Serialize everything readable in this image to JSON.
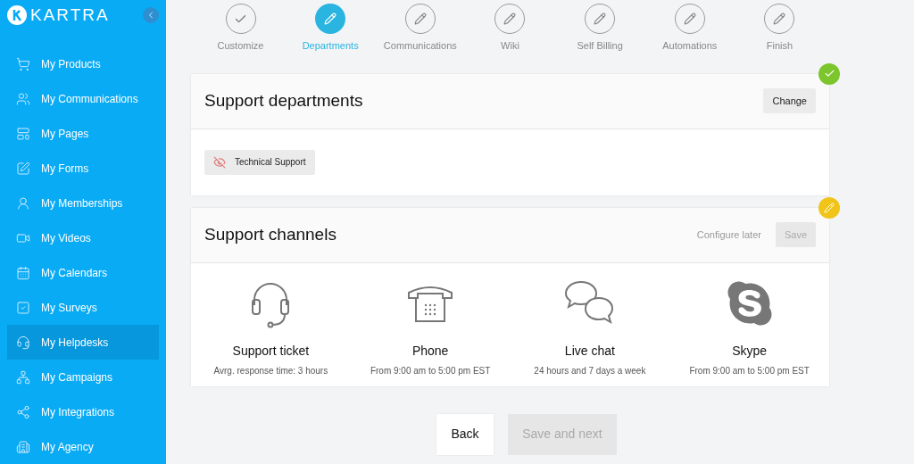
{
  "sidebar": {
    "brand": "KARTRA",
    "items": [
      {
        "label": "My Products",
        "selected": false
      },
      {
        "label": "My Communications",
        "selected": false
      },
      {
        "label": "My Pages",
        "selected": false
      },
      {
        "label": "My Forms",
        "selected": false
      },
      {
        "label": "My Memberships",
        "selected": false
      },
      {
        "label": "My Videos",
        "selected": false
      },
      {
        "label": "My Calendars",
        "selected": false
      },
      {
        "label": "My Surveys",
        "selected": false
      },
      {
        "label": "My Helpdesks",
        "selected": true
      },
      {
        "label": "My Campaigns",
        "selected": false
      },
      {
        "label": "My Integrations",
        "selected": false
      },
      {
        "label": "My Agency",
        "selected": false
      }
    ]
  },
  "steps": [
    {
      "label": "Customize",
      "kind": "done",
      "selected": false
    },
    {
      "label": "Departments",
      "kind": "edit",
      "selected": true
    },
    {
      "label": "Communications",
      "kind": "edit",
      "selected": false
    },
    {
      "label": "Wiki",
      "kind": "edit",
      "selected": false
    },
    {
      "label": "Self Billing",
      "kind": "edit",
      "selected": false
    },
    {
      "label": "Automations",
      "kind": "edit",
      "selected": false
    },
    {
      "label": "Finish",
      "kind": "edit",
      "selected": false
    }
  ],
  "departments_card": {
    "title": "Support departments",
    "kind": "done",
    "button": "Change",
    "tags": [
      {
        "label": "Technical Support"
      }
    ]
  },
  "channels_card": {
    "title": "Support channels",
    "kind": "editing",
    "link": "Configure later",
    "save": {
      "label": "Save",
      "disabled": true
    },
    "channels": [
      {
        "kind": "ticket",
        "name": "Support ticket",
        "detail": "Avrg. response time: 3 hours"
      },
      {
        "kind": "phone",
        "name": "Phone",
        "detail": "From 9:00 am to 5:00 pm EST"
      },
      {
        "kind": "chat",
        "name": "Live chat",
        "detail": "24 hours and 7 days a week"
      },
      {
        "kind": "skype",
        "name": "Skype",
        "detail": "From 9:00 am to 5:00 pm EST"
      }
    ]
  },
  "footer": {
    "back": "Back",
    "next": {
      "label": "Save and next",
      "disabled": true
    }
  }
}
